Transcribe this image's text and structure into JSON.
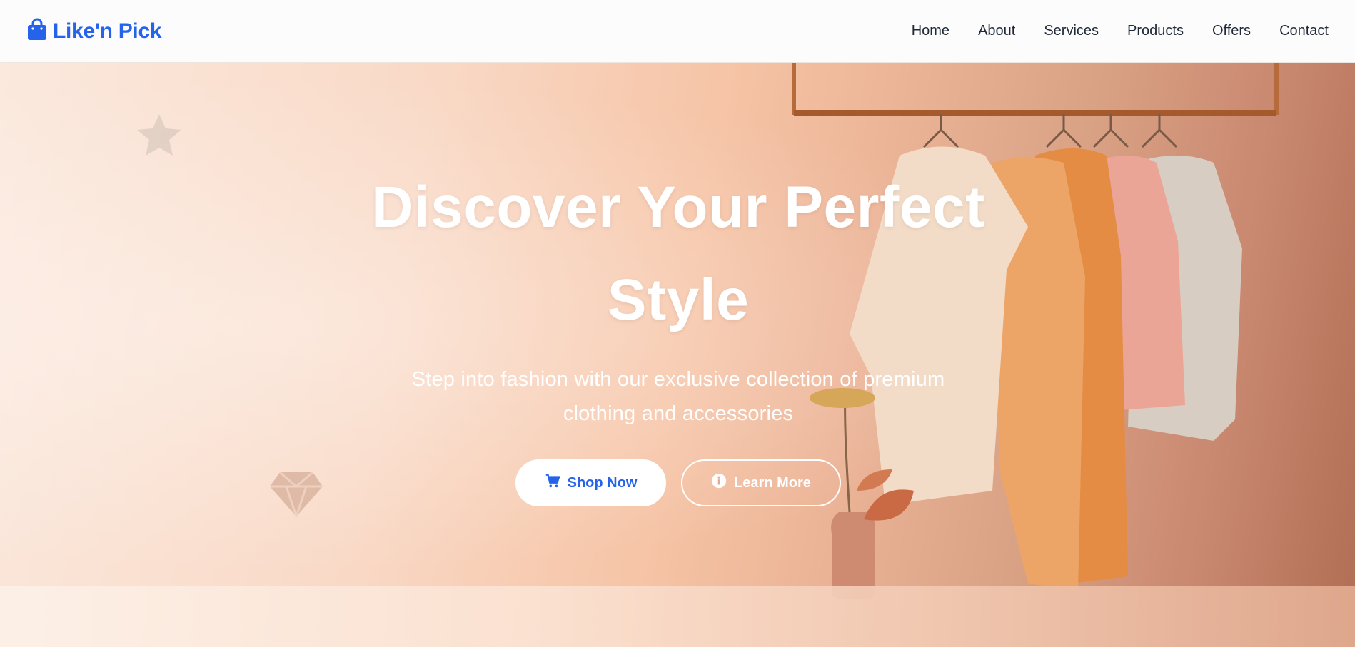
{
  "brand": {
    "name": "Like'n Pick",
    "icon": "shopping-bag-icon",
    "color": "#2563eb"
  },
  "nav": {
    "items": [
      {
        "label": "Home"
      },
      {
        "label": "About"
      },
      {
        "label": "Services"
      },
      {
        "label": "Products"
      },
      {
        "label": "Offers"
      },
      {
        "label": "Contact"
      }
    ]
  },
  "hero": {
    "title": "Discover Your Perfect Style",
    "subtitle": "Step into fashion with our exclusive collection of premium clothing and accessories",
    "primary_button": {
      "label": "Shop Now",
      "icon": "cart-icon"
    },
    "secondary_button": {
      "label": "Learn More",
      "icon": "info-icon"
    },
    "decorations": [
      "star-icon",
      "gem-icon"
    ]
  },
  "colors": {
    "accent": "#2563eb",
    "hero_text": "#ffffff",
    "nav_text": "#1f2937"
  }
}
